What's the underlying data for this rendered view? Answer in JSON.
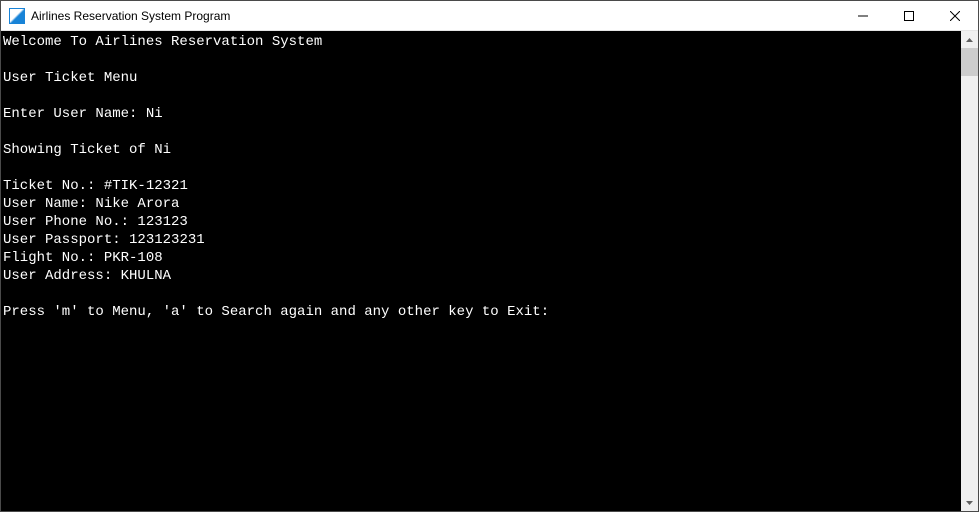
{
  "window": {
    "title": "Airlines Reservation System Program"
  },
  "console": {
    "welcome": "Welcome To Airlines Reservation System",
    "menu_title": "User Ticket Menu",
    "prompt_user_label": "Enter User Name: ",
    "prompt_user_value": "Ni",
    "showing_prefix": "Showing Ticket of ",
    "showing_user": "Ni",
    "ticket": {
      "ticket_no_label": "Ticket No.: ",
      "ticket_no_value": "#TIK-12321",
      "user_name_label": "User Name: ",
      "user_name_value": "Nike Arora",
      "phone_label": "User Phone No.: ",
      "phone_value": "123123",
      "passport_label": "User Passport: ",
      "passport_value": "123123231",
      "flight_label": "Flight No.: ",
      "flight_value": "PKR-108",
      "address_label": "User Address: ",
      "address_value": "KHULNA"
    },
    "footer_prompt": "Press 'm' to Menu, 'a' to Search again and any other key to Exit:"
  }
}
